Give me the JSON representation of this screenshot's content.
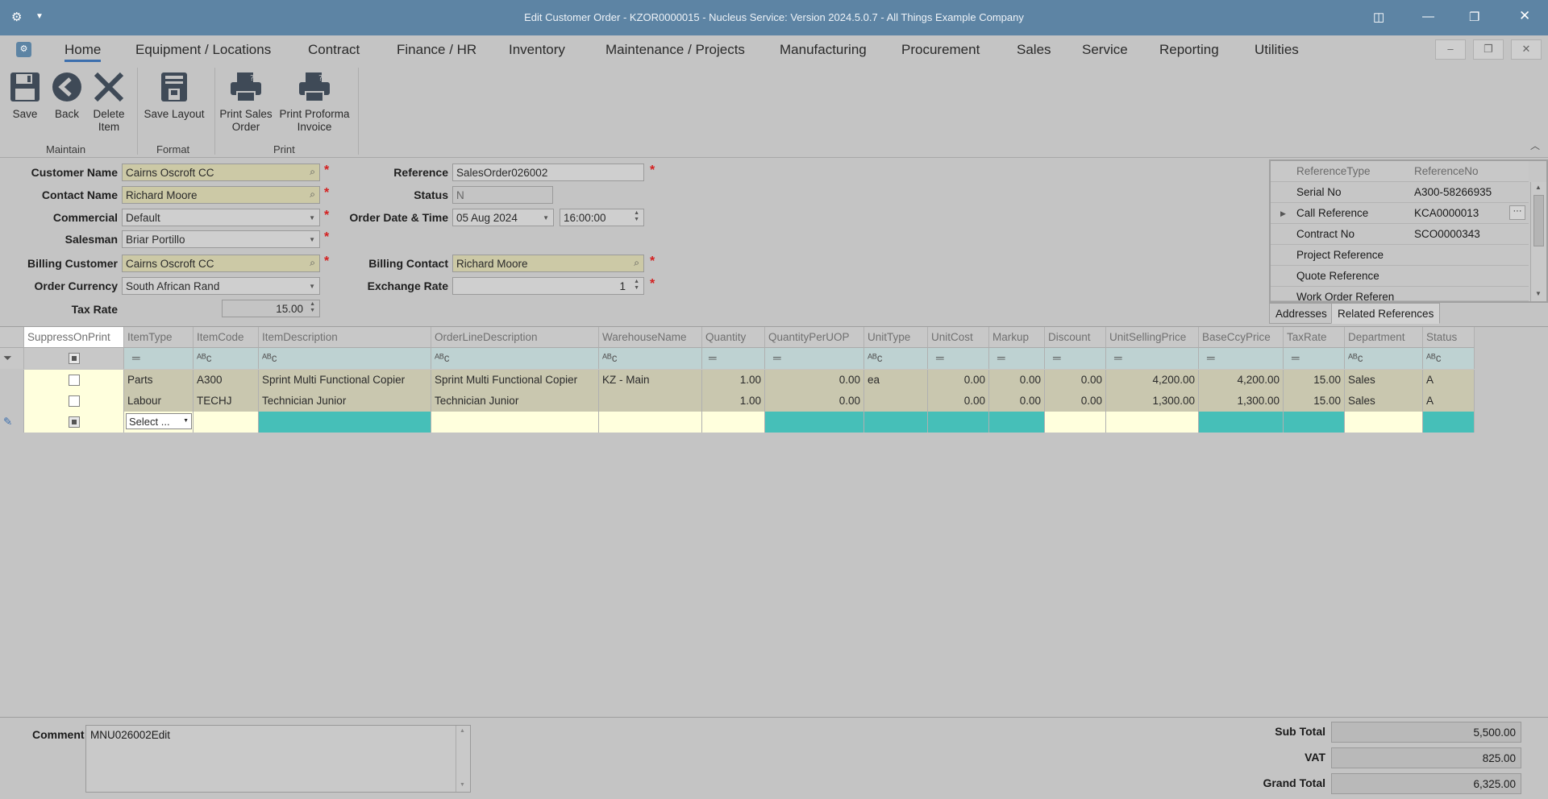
{
  "window": {
    "title": "Edit Customer Order - KZOR0000015 - Nucleus Service: Version 2024.5.0.7 - All Things Example Company"
  },
  "menu": [
    "Home",
    "Equipment / Locations",
    "Contract",
    "Finance / HR",
    "Inventory",
    "Maintenance / Projects",
    "Manufacturing",
    "Procurement",
    "Sales",
    "Service",
    "Reporting",
    "Utilities"
  ],
  "ribbon": {
    "save": "Save",
    "back": "Back",
    "delete_1": "Delete",
    "delete_2": "Item",
    "save_layout": "Save Layout",
    "print_sales_1": "Print Sales",
    "print_sales_2": "Order",
    "print_proforma_1": "Print Proforma",
    "print_proforma_2": "Invoice",
    "group_maintain": "Maintain",
    "group_format": "Format",
    "group_print": "Print"
  },
  "form": {
    "customer_name_label": "Customer Name",
    "customer_name": "Cairns Oscroft CC",
    "contact_name_label": "Contact Name",
    "contact_name": "Richard Moore",
    "commercial_label": "Commercial",
    "commercial": "Default",
    "salesman_label": "Salesman",
    "salesman": "Briar Portillo",
    "billing_customer_label": "Billing Customer",
    "billing_customer": "Cairns Oscroft CC",
    "order_currency_label": "Order Currency",
    "order_currency": "South African Rand",
    "tax_rate_label": "Tax Rate",
    "tax_rate": "15.00",
    "reference_label": "Reference",
    "reference": "SalesOrder026002",
    "status_label": "Status",
    "status": "N",
    "order_date_label": "Order Date & Time",
    "order_date": "05 Aug 2024",
    "order_time": "16:00:00",
    "billing_contact_label": "Billing Contact",
    "billing_contact": "Richard Moore",
    "exchange_rate_label": "Exchange Rate",
    "exchange_rate": "1"
  },
  "references": {
    "header_type": "ReferenceType",
    "header_no": "ReferenceNo",
    "rows": [
      {
        "type": "Serial No",
        "no": "A300-58266935"
      },
      {
        "type": "Call Reference",
        "no": "KCA0000013"
      },
      {
        "type": "Contract No",
        "no": "SCO0000343"
      },
      {
        "type": "Project Reference",
        "no": ""
      },
      {
        "type": "Quote Reference",
        "no": ""
      },
      {
        "type": "Work Order Referen",
        "no": ""
      }
    ],
    "tab_addresses": "Addresses",
    "tab_related": "Related References"
  },
  "grid": {
    "headers": [
      "SuppressOnPrint",
      "ItemType",
      "ItemCode",
      "ItemDescription",
      "OrderLineDescription",
      "WarehouseName",
      "Quantity",
      "QuantityPerUOP",
      "UnitType",
      "UnitCost",
      "Markup",
      "Discount",
      "UnitSellingPrice",
      "BaseCcyPrice",
      "TaxRate",
      "Department",
      "Status"
    ],
    "rows": [
      {
        "itemtype": "Parts",
        "itemcode": "A300",
        "itemdesc": "Sprint Multi Functional Copier",
        "linedesc": "Sprint Multi Functional Copier",
        "warehouse": "KZ - Main",
        "qty": "1.00",
        "qtyuop": "0.00",
        "unittype": "ea",
        "unitcost": "0.00",
        "markup": "0.00",
        "discount": "0.00",
        "usp": "4,200.00",
        "baseccy": "4,200.00",
        "taxrate": "15.00",
        "dept": "Sales",
        "status": "A"
      },
      {
        "itemtype": "Labour",
        "itemcode": "TECHJ",
        "itemdesc": "Technician Junior",
        "linedesc": "Technician Junior",
        "warehouse": "",
        "qty": "1.00",
        "qtyuop": "0.00",
        "unittype": "",
        "unitcost": "0.00",
        "markup": "0.00",
        "discount": "0.00",
        "usp": "1,300.00",
        "baseccy": "1,300.00",
        "taxrate": "15.00",
        "dept": "Sales",
        "status": "A"
      }
    ],
    "new_row_select": "Select ..."
  },
  "footer": {
    "comment_label": "Comment",
    "comment": "MNU026002Edit",
    "subtotal_label": "Sub Total",
    "subtotal": "5,500.00",
    "vat_label": "VAT",
    "vat": "825.00",
    "grandtotal_label": "Grand Total",
    "grandtotal": "6,325.00"
  }
}
